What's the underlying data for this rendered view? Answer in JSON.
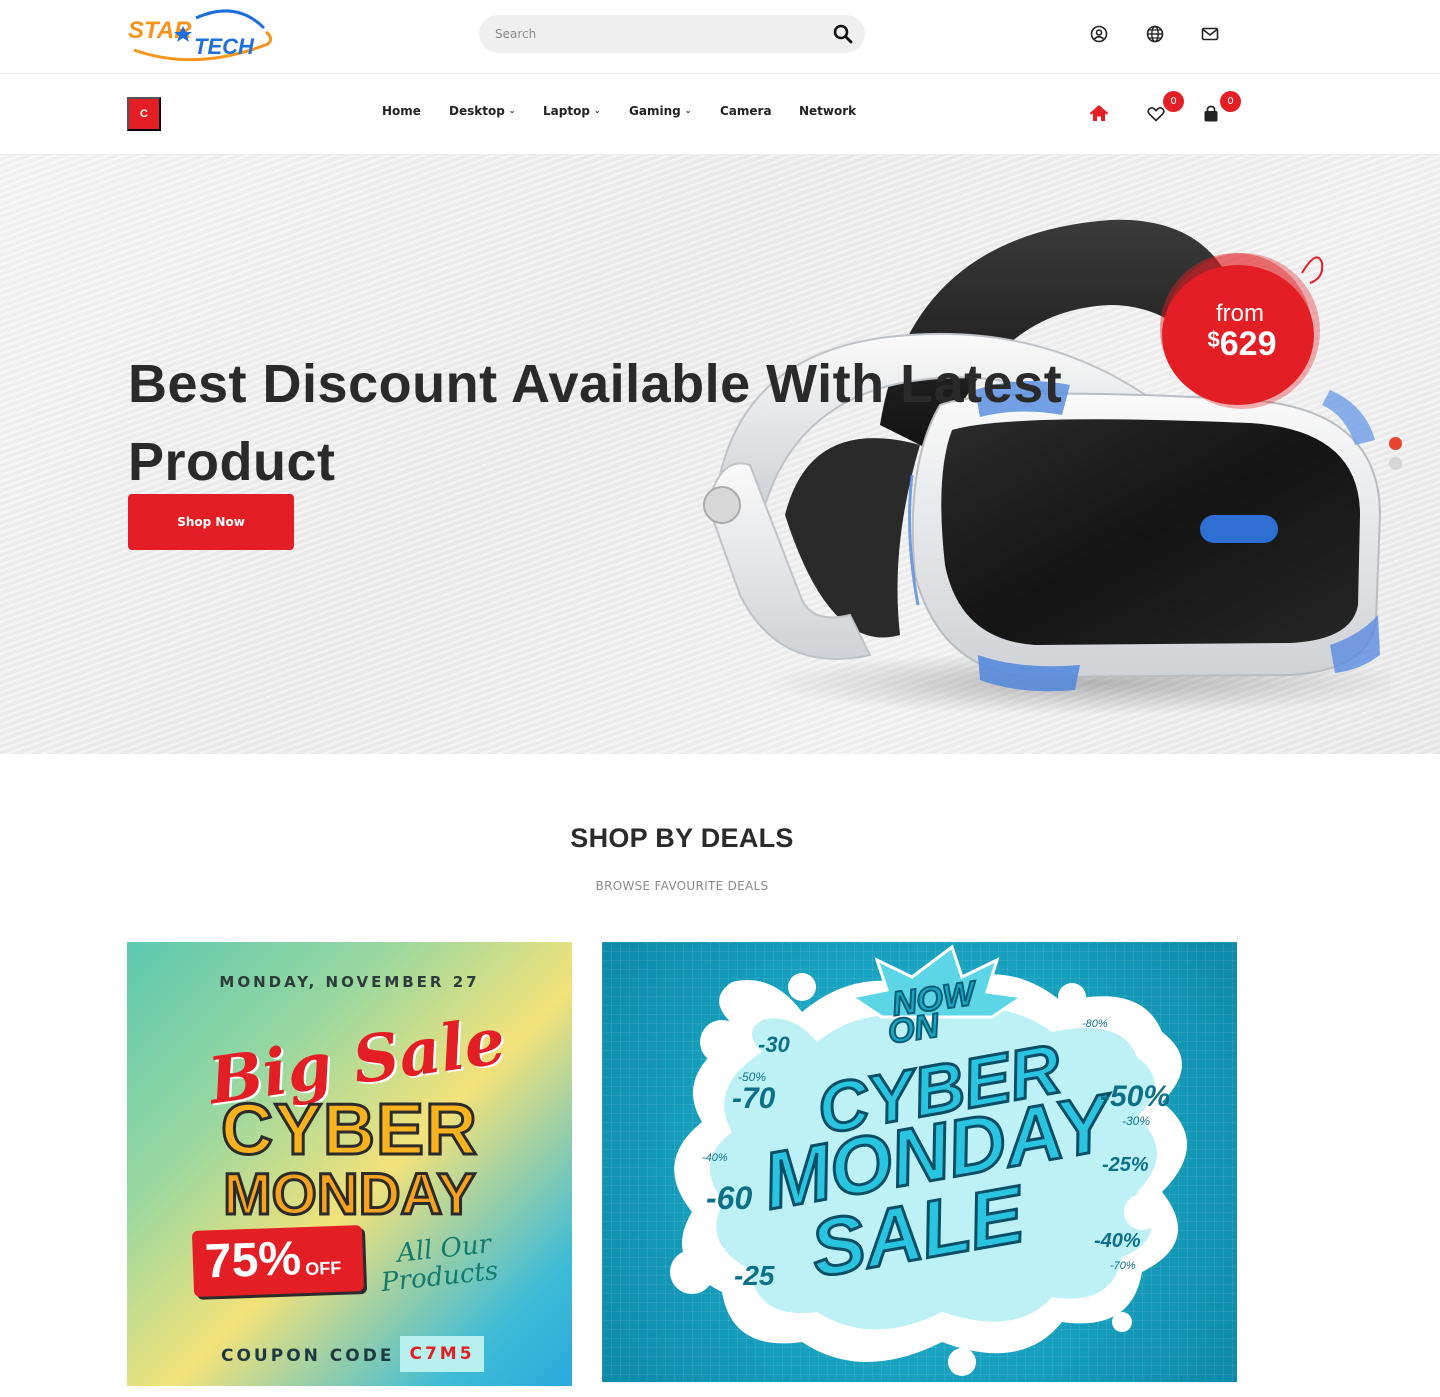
{
  "brand": {
    "logo_star": "STAR",
    "logo_tech": "TECH"
  },
  "search": {
    "placeholder": "Search"
  },
  "top_icons": [
    "user-circle-icon",
    "globe-icon",
    "envelope-icon"
  ],
  "category_button": {
    "label": "C"
  },
  "nav": {
    "items": [
      {
        "label": "Home",
        "dropdown": false
      },
      {
        "label": "Desktop",
        "dropdown": true
      },
      {
        "label": "Laptop",
        "dropdown": true
      },
      {
        "label": "Gaming",
        "dropdown": true
      },
      {
        "label": "Camera",
        "dropdown": false
      },
      {
        "label": "Network",
        "dropdown": false
      }
    ],
    "wishlist_count": "0",
    "cart_count": "0"
  },
  "hero": {
    "title": "Best Discount Available With Latest Product",
    "button_label": "Shop Now",
    "price_from": "from",
    "price_currency": "$",
    "price_value": "629",
    "slides_total": 2,
    "active_slide": 1
  },
  "deals": {
    "title": "SHOP BY DEALS",
    "subtitle": "BROWSE FAVOURITE DEALS",
    "card1": {
      "date": "MONDAY, NOVEMBER 27",
      "script": "Big Sale",
      "line1": "CYBER",
      "line2": "MONDAY",
      "percent": "75%",
      "off": "OFF",
      "all1": "All Our",
      "all2": "Products",
      "coupon_label": "COUPON CODE",
      "coupon_code": "C7M5"
    },
    "card2": {
      "now": "NOW",
      "on": "ON",
      "line1": "CYBER",
      "line2": "MONDAY",
      "line3": "SALE",
      "discounts": [
        "-30",
        "-70",
        "-50%",
        "-60",
        "-25",
        "-50%",
        "-30%",
        "-25%",
        "-40%",
        "-70%",
        "-40%",
        "-80%"
      ]
    }
  },
  "colors": {
    "accent": "#e31e24",
    "logo_orange": "#f7941d",
    "logo_blue": "#1e6fd9"
  }
}
